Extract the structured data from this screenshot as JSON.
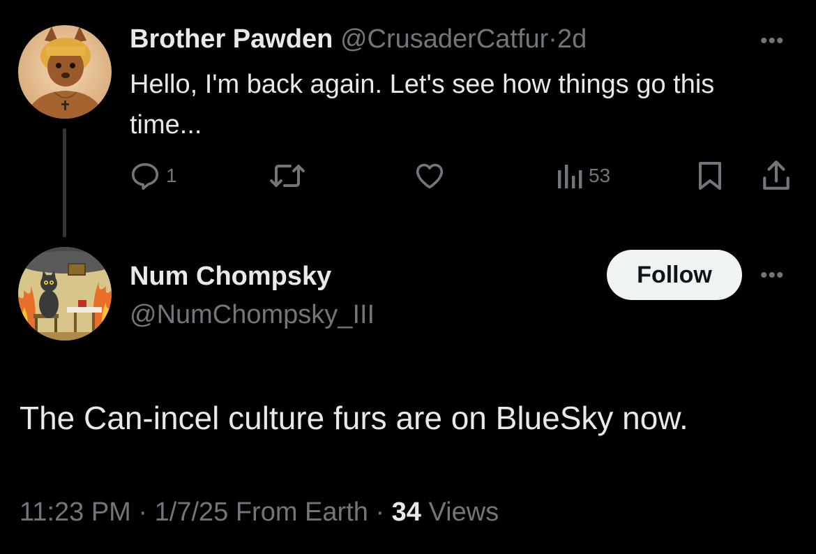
{
  "parent_tweet": {
    "display_name": "Brother Pawden",
    "handle": "@CrusaderCatfur",
    "separator": "·",
    "time_ago": "2d",
    "text": "Hello, I'm back again. Let's see how things go this time...",
    "more_label": "•••",
    "actions": {
      "reply_count": "1",
      "retweet_count": "",
      "like_count": "",
      "view_count": "53"
    }
  },
  "main_tweet": {
    "display_name": "Num Chompsky",
    "handle": "@NumChompsky_III",
    "follow_label": "Follow",
    "more_label": "•••",
    "text": "The Can-incel culture furs are on BlueSky now.",
    "time": "11:23 PM",
    "date": "1/7/25",
    "location": "From Earth",
    "separator": "·",
    "views_count": "34",
    "views_label": "Views"
  },
  "colors": {
    "background": "#000000",
    "text": "#e7e9ea",
    "muted": "#71767b",
    "follow_bg": "#eff3f4"
  }
}
